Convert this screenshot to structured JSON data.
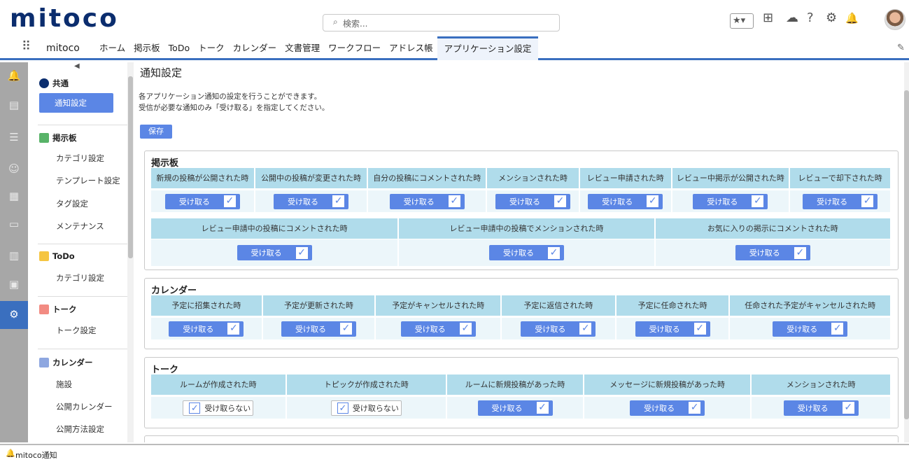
{
  "header": {
    "logo": "mitoco",
    "search_placeholder": "検索...",
    "search_icon": "magnifier-icon",
    "icons": [
      "star-icon",
      "plus-icon",
      "trailhead-icon",
      "help-icon",
      "gear-icon",
      "bell-icon"
    ]
  },
  "nav": {
    "app_name": "mitoco",
    "tabs": [
      "ホーム",
      "掲示板",
      "ToDo",
      "トーク",
      "カレンダー",
      "文書管理",
      "ワークフロー",
      "アドレス帳",
      "アプリケーション設定"
    ],
    "active_tab": "アプリケーション設定"
  },
  "sidebar": {
    "groups": [
      {
        "title": "共通",
        "items": [
          "通知設定"
        ]
      },
      {
        "title": "掲示板",
        "items": [
          "カテゴリ設定",
          "テンプレート設定",
          "タグ設定",
          "メンテナンス"
        ]
      },
      {
        "title": "ToDo",
        "items": [
          "カテゴリ設定"
        ]
      },
      {
        "title": "トーク",
        "items": [
          "トーク設定"
        ]
      },
      {
        "title": "カレンダー",
        "items": [
          "施設",
          "公開カレンダー",
          "公開方法設定"
        ]
      }
    ],
    "active_item": "通知設定"
  },
  "main": {
    "title": "通知設定",
    "desc1": "各アプリケーション通知の設定を行うことができます。",
    "desc2": "受信が必要な通知のみ「受け取る」を指定してください。",
    "save_label": "保存",
    "on_label": "受け取る",
    "off_label": "受け取らない",
    "sections": [
      {
        "title": "掲示板",
        "rows": [
          {
            "headers": [
              "新規の投稿が公開された時",
              "公開中の投稿が変更された時",
              "自分の投稿にコメントされた時",
              "メンションされた時",
              "レビュー申請された時",
              "レビュー中掲示が公開された時",
              "レビューで却下された時"
            ],
            "states": [
              true,
              true,
              true,
              true,
              true,
              true,
              true
            ]
          },
          {
            "headers": [
              "レビュー申請中の投稿にコメントされた時",
              "レビュー申請中の投稿でメンションされた時",
              "お気に入りの掲示にコメントされた時"
            ],
            "states": [
              true,
              true,
              true
            ]
          }
        ]
      },
      {
        "title": "カレンダー",
        "rows": [
          {
            "headers": [
              "予定に招集された時",
              "予定が更新された時",
              "予定がキャンセルされた時",
              "予定に返信された時",
              "予定に任命された時",
              "任命された予定がキャンセルされた時"
            ],
            "states": [
              true,
              true,
              true,
              true,
              true,
              true
            ]
          }
        ]
      },
      {
        "title": "トーク",
        "rows": [
          {
            "headers": [
              "ルームが作成された時",
              "トピックが作成された時",
              "ルームに新規投稿があった時",
              "メッセージに新規投稿があった時",
              "メンションされた時"
            ],
            "states": [
              false,
              false,
              true,
              true,
              true
            ]
          }
        ]
      }
    ]
  },
  "footer": {
    "label": "mitoco通知"
  }
}
